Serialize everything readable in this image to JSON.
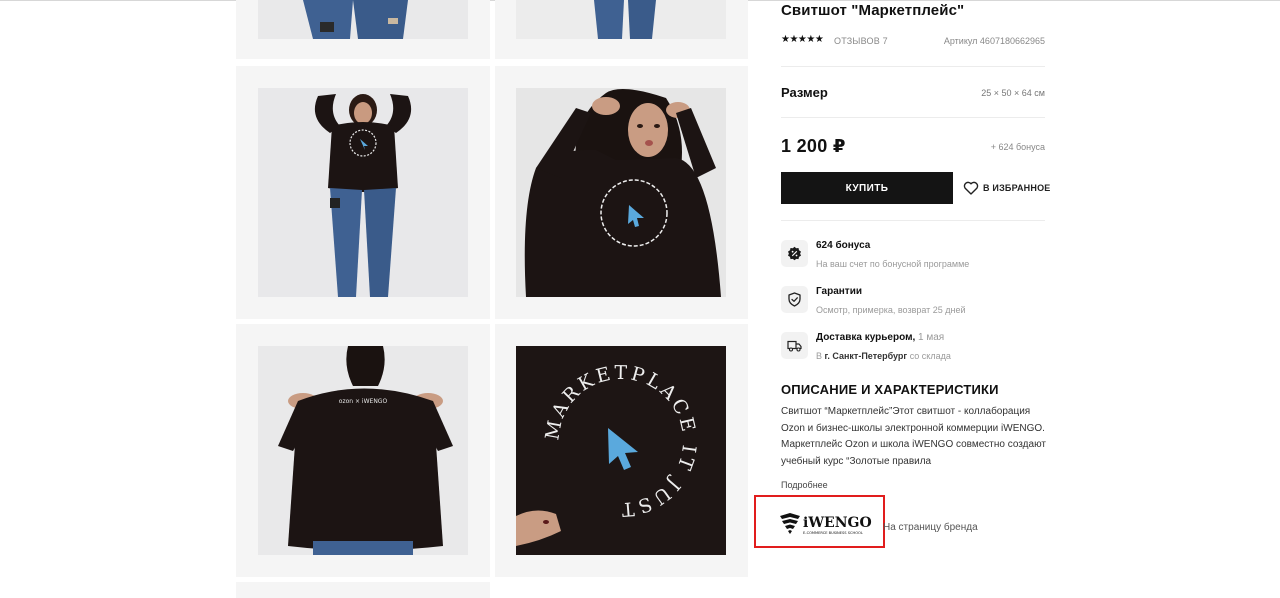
{
  "product": {
    "title": "Свитшот \"Маркетплейс\"",
    "stars": "★★★★★",
    "reviews": "ОТЗЫВОВ 7",
    "sku": "Артикул 4607180662965"
  },
  "size": {
    "label": "Размер",
    "value": "25 × 50 × 64 см"
  },
  "price": {
    "value": "1 200 ₽",
    "bonus": "+ 624 бонуса"
  },
  "actions": {
    "buy": "КУПИТЬ",
    "favorite": "В ИЗБРАННОЕ"
  },
  "features": [
    {
      "icon": "bonus-icon",
      "title": "624 бонуса",
      "subtitle": "На ваш счет по бонусной программе"
    },
    {
      "icon": "shield-icon",
      "title": "Гарантии",
      "subtitle": "Осмотр, примерка, возврат 25 дней"
    },
    {
      "icon": "truck-icon",
      "title": "Доставка курьером,",
      "title_muted": "1 мая",
      "subtitle_prefix": "В",
      "subtitle_city": "г. Санкт-Петербург",
      "subtitle_suffix": "со склада"
    }
  ],
  "description": {
    "title": "ОПИСАНИЕ И ХАРАКТЕРИСТИКИ",
    "text": "Свитшот “Маркетплейс”Этот свитшот - коллаборация Ozon и бизнес-школы электронной коммерции iWENGO. Маркетплейс Ozon и школа iWENGO совместно создают учебный курс “Золотые правила",
    "more": "Подробнее"
  },
  "brand": {
    "logo_name": "iWENGO",
    "logo_tagline": "E-COMMERCE BUSINESS SCHOOL",
    "link": "На страницу бренда"
  },
  "gallery": {
    "print_text": "MARKETPLACE IT JUST",
    "back_print": "ozon × iWENGO"
  },
  "colors": {
    "sweatshirt": "#1c1413",
    "jeans": "#3c5f8f",
    "cursor": "#5aa9dd",
    "tile_bg": "#f5f5f5",
    "highlight": "#e11d1d"
  }
}
